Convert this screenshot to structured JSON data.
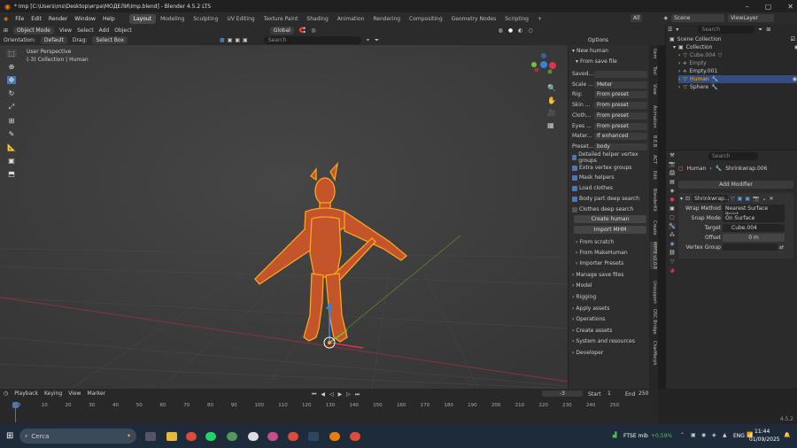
{
  "window": {
    "title": "* Imp [C:\\Users\\ms\\Desktop\\игра\\МОДЕЛИ\\Imp.blend] - Blender 4.5.2 LTS"
  },
  "menus": [
    "File",
    "Edit",
    "Render",
    "Window",
    "Help"
  ],
  "workspaces": [
    "Layout",
    "Modeling",
    "Sculpting",
    "UV Editing",
    "Texture Paint",
    "Shading",
    "Animation",
    "Rendering",
    "Compositing",
    "Geometry Nodes",
    "Scripting",
    "+"
  ],
  "topright": {
    "scene_label": "Scene",
    "viewlayer_label": "ViewLayer",
    "all_label": "All"
  },
  "header": {
    "mode": "Object Mode",
    "view": "View",
    "select": "Select",
    "add": "Add",
    "object": "Object",
    "transform": "Global",
    "search": "Search"
  },
  "options_bar": {
    "orientation_label": "Orientation:",
    "orientation_value": "Default",
    "drag_label": "Drag:",
    "drag_value": "Select Box",
    "options": "Options"
  },
  "viewport": {
    "perspective": "User Perspective",
    "collection": "(-3) Collection | Human"
  },
  "npanel": {
    "new_human": "New human",
    "from_save_file": "From save file",
    "saved_label": "Saved...",
    "fields": [
      {
        "label": "Scale ...",
        "value": "Meter"
      },
      {
        "label": "Rig:",
        "value": "From preset"
      },
      {
        "label": "Skin ...",
        "value": "From preset"
      },
      {
        "label": "Cloth...",
        "value": "From preset"
      },
      {
        "label": "Eyes ...",
        "value": "From preset"
      },
      {
        "label": "Mater...",
        "value": "If enhanced"
      },
      {
        "label": "Preset...",
        "value": "body"
      }
    ],
    "checks": [
      {
        "label": "Detailed helper vertex groups",
        "on": true
      },
      {
        "label": "Extra vertex groups",
        "on": true
      },
      {
        "label": "Mask helpers",
        "on": true
      },
      {
        "label": "Load clothes",
        "on": true
      },
      {
        "label": "Body part deep search",
        "on": true
      },
      {
        "label": "Clothes deep search",
        "on": false
      }
    ],
    "create_human": "Create human",
    "import_mhm": "Import MHM",
    "sub": [
      "From scratch",
      "From MakeHuman",
      "Importer Presets"
    ],
    "sections": [
      "Manage save files",
      "Model",
      "Rigging",
      "Apply assets",
      "Operations",
      "Create assets",
      "System and resources",
      "Developer"
    ]
  },
  "sidetabs": [
    "Item",
    "Tool",
    "View",
    "Animation",
    "B.E.B",
    "ACT",
    "Edit",
    "BlenderKit",
    "Create",
    "MPFB v2.0.8",
    "Unsupport",
    "OSC Bridge",
    "CharMorph"
  ],
  "outliner": {
    "search": "Search",
    "root": "Scene Collection",
    "collection": "Collection",
    "items": [
      "Cube.004",
      "Empty",
      "Empty.001",
      "Human",
      "Sphere"
    ]
  },
  "properties": {
    "search": "Search",
    "object": "Human",
    "modifier_name": "Shrinkwrap.006",
    "add_modifier": "Add Modifier",
    "mod_short": "Shrinkwrap...",
    "rows": [
      {
        "label": "Wrap Method",
        "value": "Nearest Surface Point"
      },
      {
        "label": "Snap Mode",
        "value": "On Surface"
      },
      {
        "label": "Target",
        "value": "Cube.004"
      },
      {
        "label": "Offset",
        "value": "0 m"
      },
      {
        "label": "Vertex Group",
        "value": ""
      }
    ]
  },
  "timeline": {
    "playback": "Playback",
    "keying": "Keying",
    "view": "View",
    "marker": "Marker",
    "current": "-3",
    "start_label": "Start",
    "start": "1",
    "end_label": "End",
    "end": "250",
    "ticks": [
      "-3",
      "0",
      "10",
      "20",
      "30",
      "40",
      "50",
      "60",
      "70",
      "80",
      "90",
      "100",
      "110",
      "120",
      "130",
      "140",
      "150",
      "160",
      "170",
      "180",
      "190",
      "200",
      "210",
      "220",
      "230",
      "240",
      "250"
    ]
  },
  "status": {
    "version": "4.5.2"
  },
  "taskbar": {
    "search": "Cerca",
    "stock": "FTSE mib",
    "stock_change": "+0,59%",
    "lang": "ENG",
    "time": "11:44",
    "date": "01/09/2025"
  },
  "colors": {
    "accent": "#4b77b5",
    "orange": "#ffa41c",
    "model": "#c4552a",
    "selected": "#334d80"
  }
}
